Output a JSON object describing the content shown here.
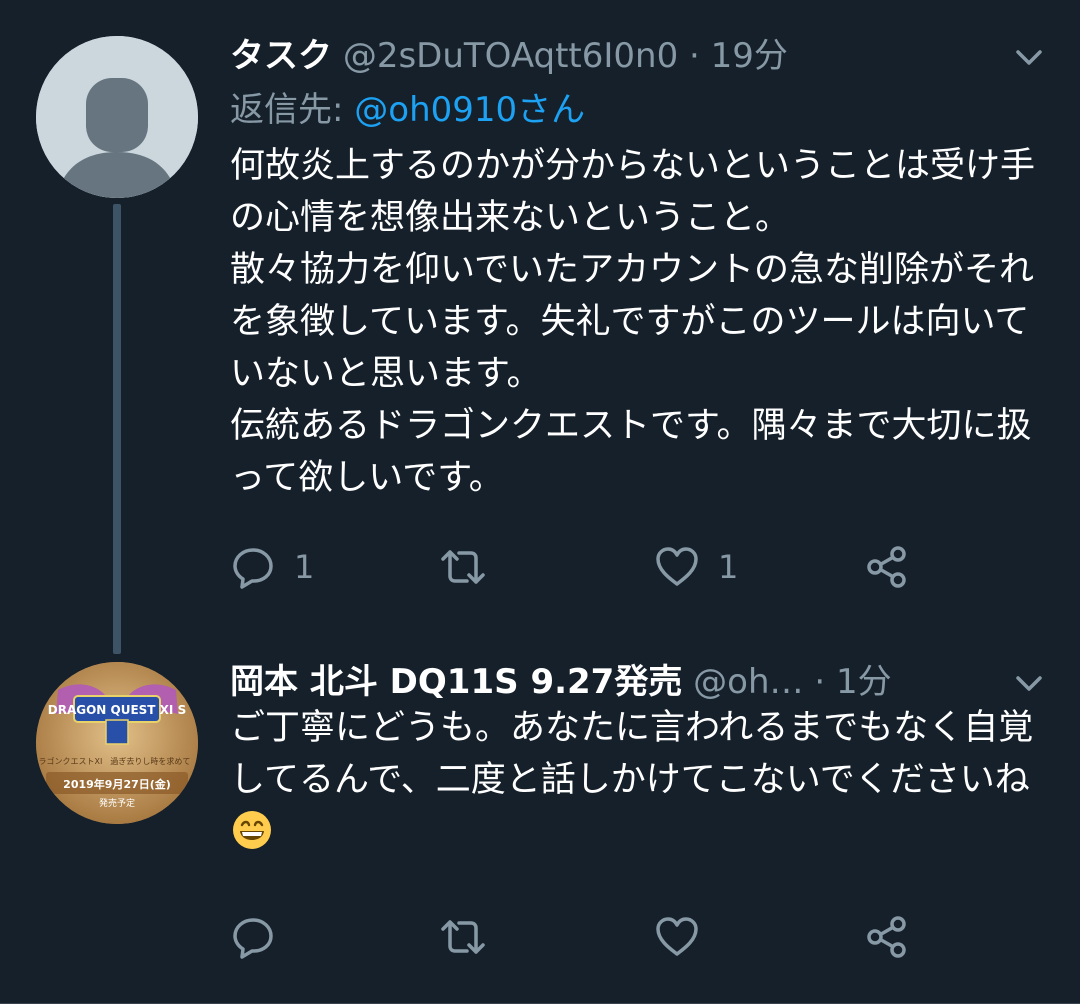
{
  "tweets": [
    {
      "author": "タスク",
      "handle": "@2sDuTOAqtt6I0n0",
      "dot": "·",
      "time": "19分",
      "reply_label": "返信先:",
      "reply_mention": "@oh0910さん",
      "text": "何故炎上するのかが分からないということは受け手の心情を想像出来ないということ。\n散々協力を仰いでいたアカウントの急な削除がそれを象徴しています。失礼ですがこのツールは向いていないと思います。\n伝統あるドラゴンクエストです。隅々まで大切に扱って欲しいです。",
      "reply_count": "1",
      "retweet_count": "",
      "like_count": "1",
      "avatar_icon": "default-user-icon"
    },
    {
      "author": "岡本 北斗 DQ11S 9.27発売",
      "handle": "@oh…",
      "dot": "·",
      "time": "1分",
      "text": "ご丁寧にどうも。あなたに言われるまでもなく自覚してるんで、二度と話しかけてこないでくださいね",
      "emoji": "grinning-face-emoji",
      "reply_count": "",
      "retweet_count": "",
      "like_count": "",
      "avatar_image": {
        "brand": "DRAGON QUEST XI S",
        "caption": "「ドラゴンクエストXI　過ぎ去りし時を求めて　S」",
        "date": "2019年9月27日(金)",
        "status": "発売予定"
      }
    }
  ],
  "colors": {
    "background": "#15202b",
    "secondary_text": "#8899a6",
    "link": "#1da1f2",
    "thread_line": "#3d5466"
  }
}
